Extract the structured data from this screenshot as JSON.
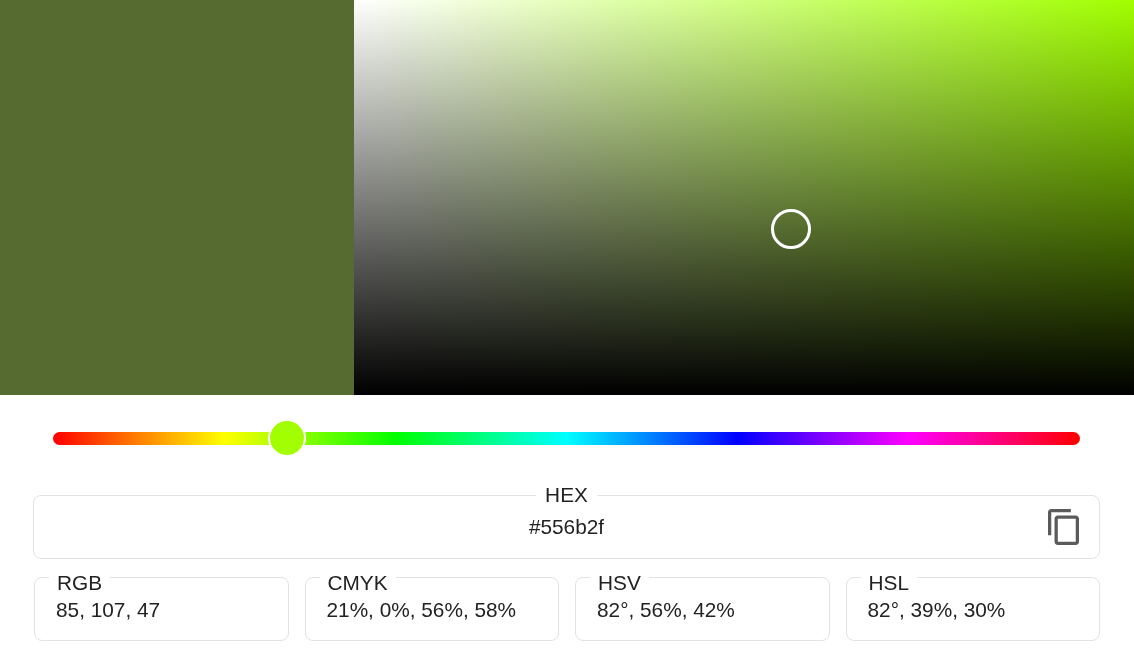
{
  "preview": {
    "color": "#556b2f"
  },
  "hue": {
    "level": 0.228
  },
  "hex": {
    "label": "HEX",
    "value": "#556b2f"
  },
  "formats": [
    {
      "label": "RGB",
      "value": "85, 107, 47"
    },
    {
      "label": "CMYK",
      "value": "21%, 0%, 56%, 58%"
    },
    {
      "label": "HSV",
      "value": "82°, 56%, 42%"
    },
    {
      "label": "HSL",
      "value": "82°, 39%, 30%"
    }
  ]
}
